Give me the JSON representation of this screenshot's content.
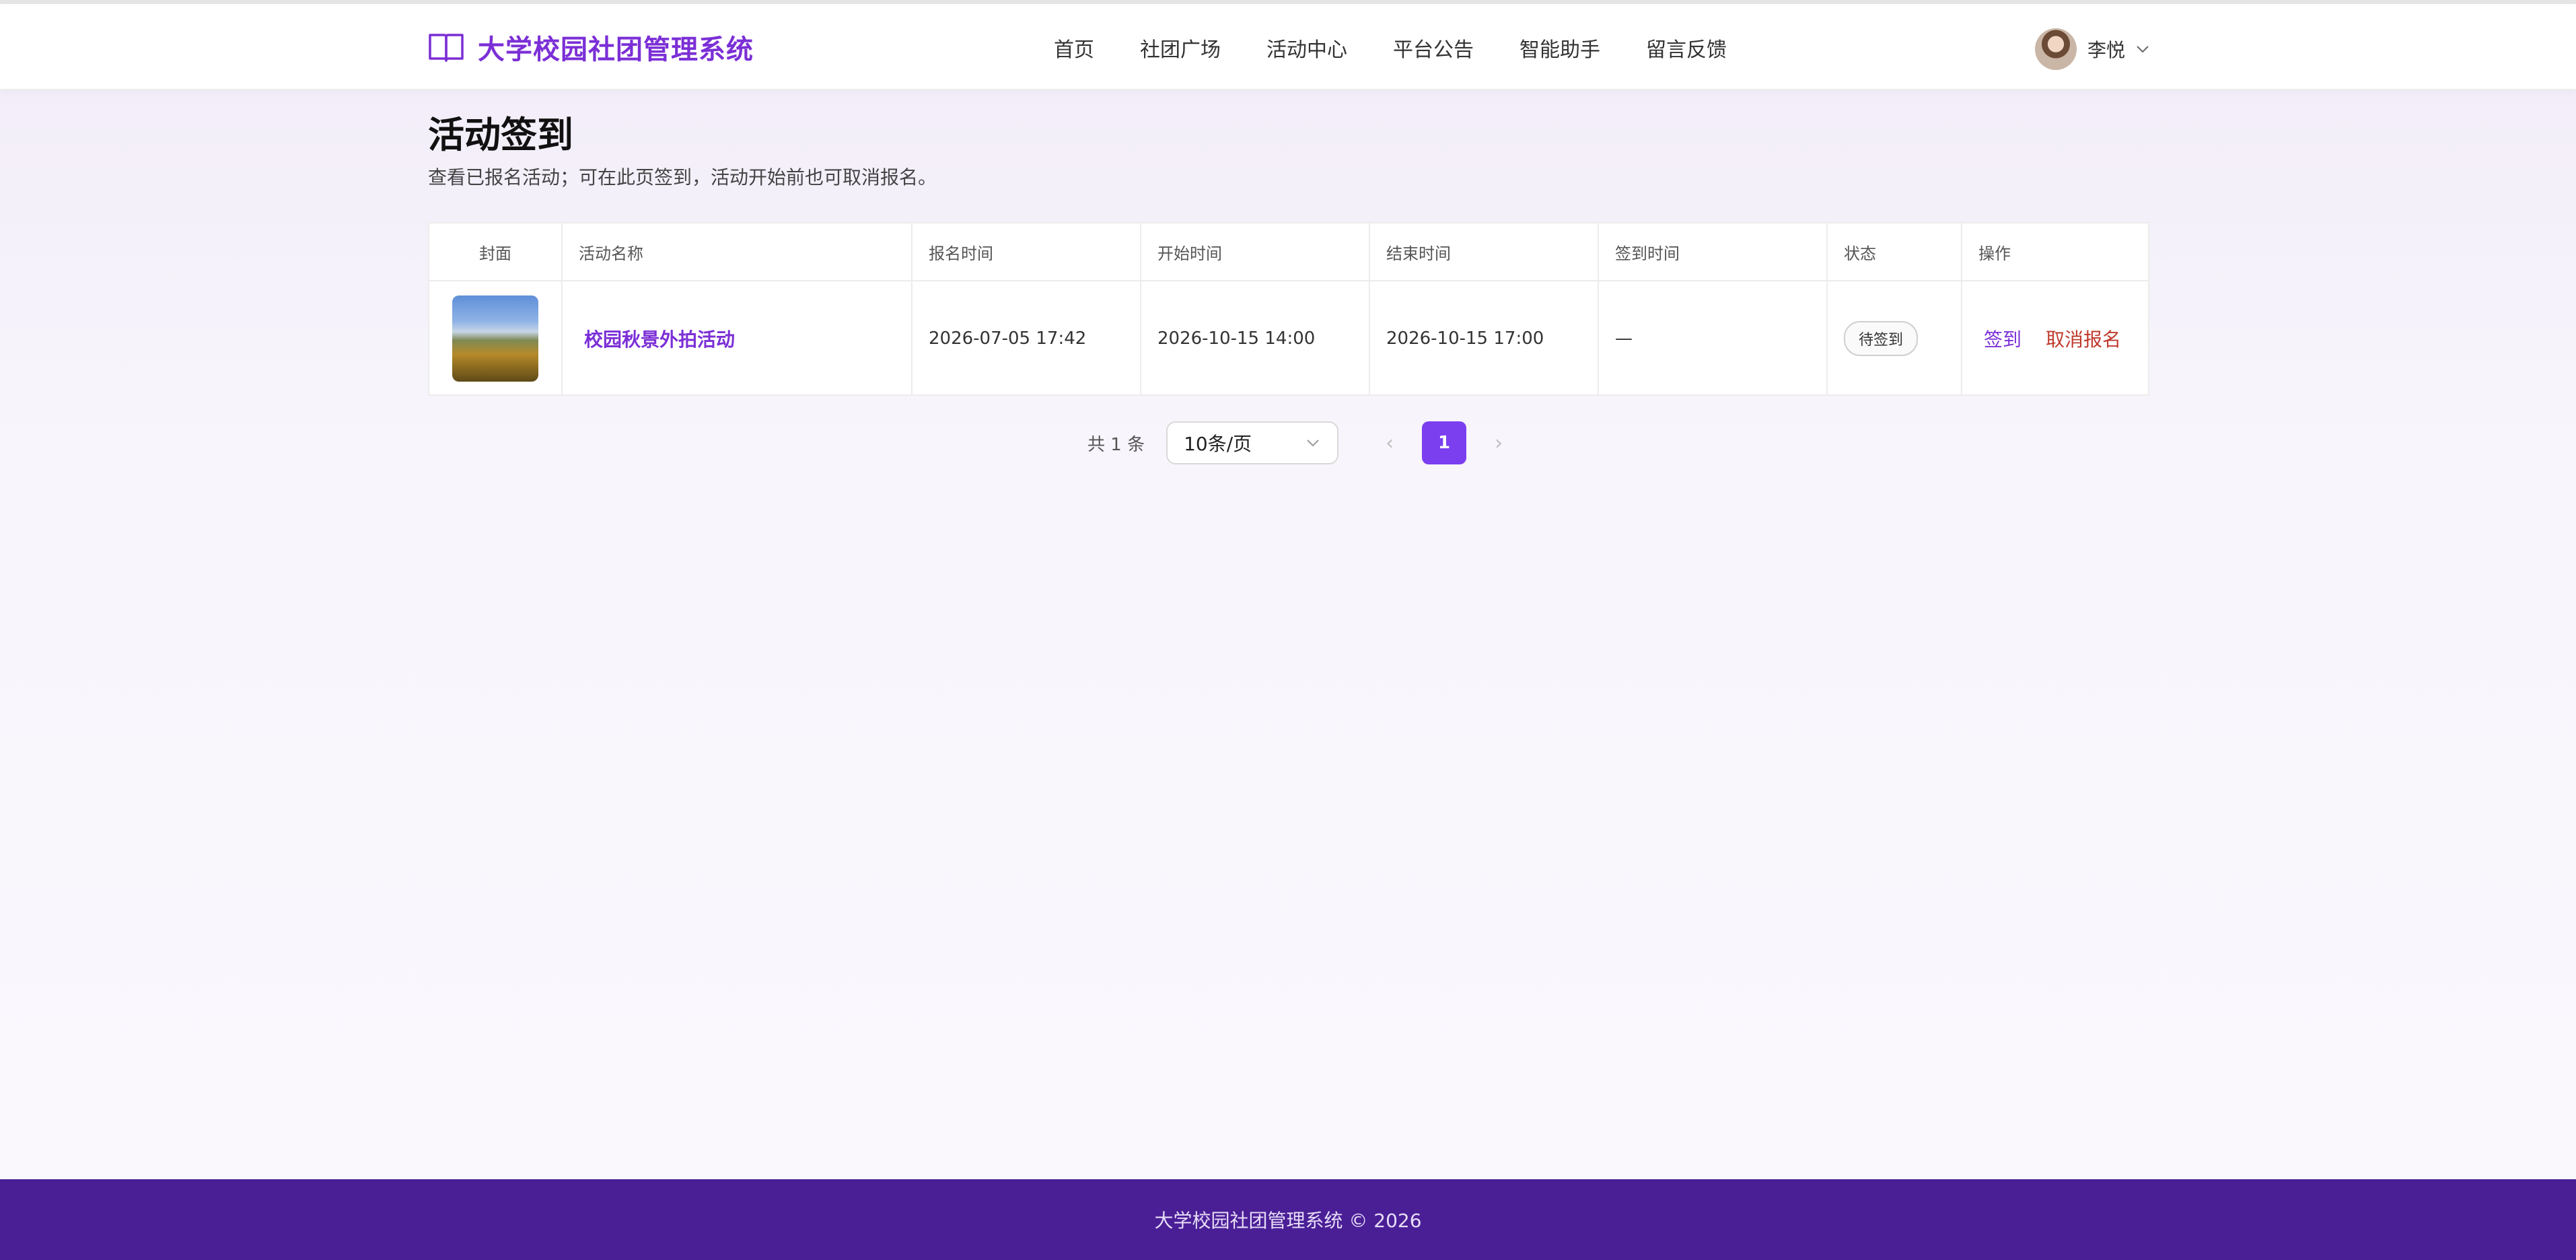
{
  "app": {
    "brand_icon": "book-open-icon",
    "title": "大学校园社团管理系统",
    "accent": "#7b2fd6"
  },
  "nav": {
    "items": [
      "首页",
      "社团广场",
      "活动中心",
      "平台公告",
      "智能助手",
      "留言反馈"
    ]
  },
  "user": {
    "name": "李悦",
    "menu_icon": "chevron-down-icon"
  },
  "page": {
    "title": "活动签到",
    "description": "查看已报名活动；可在此页签到，活动开始前也可取消报名。"
  },
  "table": {
    "columns": [
      "封面",
      "活动名称",
      "报名时间",
      "开始时间",
      "结束时间",
      "签到时间",
      "状态",
      "操作"
    ],
    "rows": [
      {
        "cover": "campus-autumn-photo",
        "name": "校园秋景外拍活动",
        "signup_time": "2026-07-05 17:42",
        "start_time": "2026-10-15 14:00",
        "end_time": "2026-10-15 17:00",
        "checkin_time": "—",
        "status": "待签到",
        "actions": {
          "checkin": "签到",
          "cancel": "取消报名"
        }
      }
    ]
  },
  "pagination": {
    "total": "共 1 条",
    "page_size": "10条/页",
    "prev_icon": "chevron-left-icon",
    "next_icon": "chevron-right-icon",
    "current_page": "1"
  },
  "footer": {
    "text": "大学校园社团管理系统 © 2026",
    "color": "#4a1f96"
  }
}
